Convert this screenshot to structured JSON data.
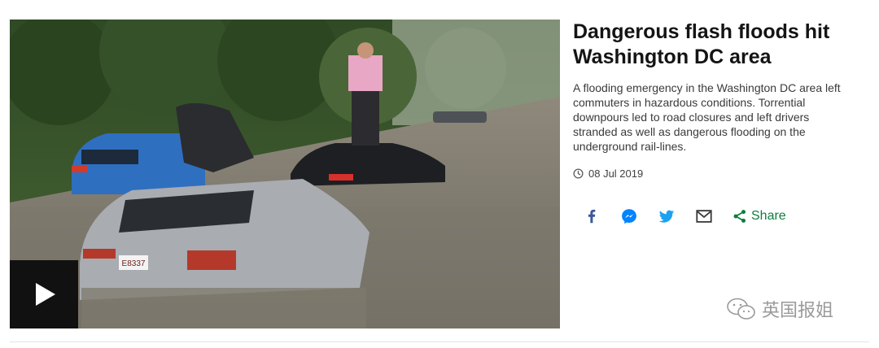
{
  "article": {
    "headline": "Dangerous flash floods hit Washington DC area",
    "summary": "A flooding emergency in the Washington DC area left commuters in hazardous conditions. Torrential downpours led to road closures and left drivers stranded as well as dangerous flooding on the underground rail-lines.",
    "date": "08 Jul 2019"
  },
  "media": {
    "play_icon": "play-icon",
    "license_plates": [
      "E8337"
    ]
  },
  "share": {
    "label": "Share",
    "icons": [
      "facebook-icon",
      "messenger-icon",
      "twitter-icon",
      "email-icon",
      "share-icon"
    ]
  },
  "watermark": {
    "text": "英国报姐"
  },
  "colors": {
    "share_accent": "#0f7d3e",
    "facebook": "#3b5998",
    "messenger": "#0084ff",
    "twitter": "#1da1f2",
    "email": "#3a3a3a",
    "play_background": "#111111"
  }
}
